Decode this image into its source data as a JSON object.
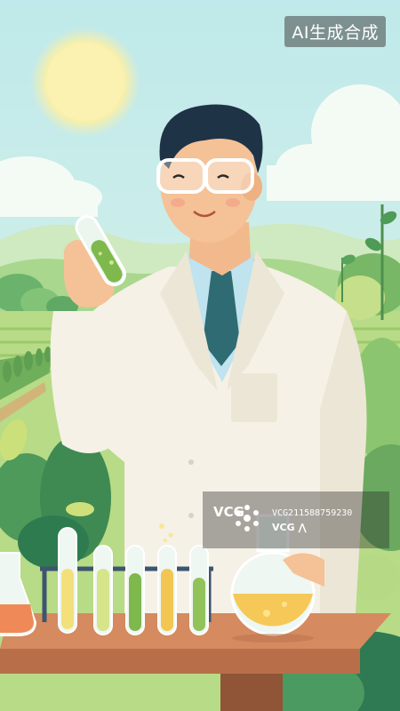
{
  "badge": {
    "text": "AI生成合成"
  },
  "watermark": {
    "logo_left": "VCG",
    "id_text": "VCG211588759230",
    "logo_right": "VCG ⋀"
  },
  "colors": {
    "sky": "#cfeef0",
    "sun": "#fbf3b0",
    "field": "#a9d27a",
    "coat": "#f6f3ea",
    "shirt": "#bfe3ef",
    "tie": "#2e6b73",
    "hair": "#1f3347",
    "table": "#c97e56",
    "liquid_green": "#7fb84c",
    "liquid_yellow": "#f3c653",
    "liquid_orange": "#ef8a58"
  }
}
